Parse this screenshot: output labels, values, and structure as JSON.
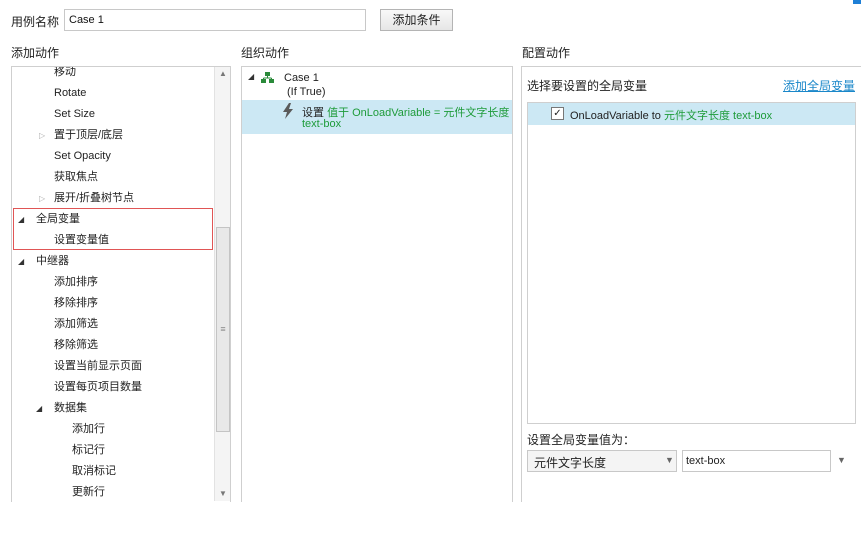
{
  "top": {
    "case_label": "用例名称",
    "case_value": "Case 1",
    "add_condition": "添加条件"
  },
  "sections": {
    "add_action": "添加动作",
    "organize_action": "组织动作",
    "configure_action": "配置动作"
  },
  "left_tree": {
    "items": [
      {
        "label": "移动"
      },
      {
        "label": "Rotate"
      },
      {
        "label": "Set Size"
      },
      {
        "label": "置于顶层/底层"
      },
      {
        "label": "Set Opacity"
      },
      {
        "label": "获取焦点"
      },
      {
        "label": "展开/折叠树节点"
      },
      {
        "label": "全局变量"
      },
      {
        "label": "设置变量值"
      },
      {
        "label": "中继器"
      },
      {
        "label": "添加排序"
      },
      {
        "label": "移除排序"
      },
      {
        "label": "添加筛选"
      },
      {
        "label": "移除筛选"
      },
      {
        "label": "设置当前显示页面"
      },
      {
        "label": "设置每页项目数量"
      },
      {
        "label": "数据集"
      },
      {
        "label": "添加行"
      },
      {
        "label": "标记行"
      },
      {
        "label": "取消标记"
      },
      {
        "label": "更新行"
      }
    ]
  },
  "middle": {
    "case_name": "Case 1",
    "case_condition": "(If True)",
    "action_prefix": "设置",
    "action_detail": "值于 OnLoadVariable = 元件文字长度",
    "action_detail_2": "text-box"
  },
  "right": {
    "select_var_title": "选择要设置的全局变量",
    "add_global_link": "添加全局变量",
    "var_name": "OnLoadVariable to",
    "var_value": "元件文字长度 text-box",
    "set_value_label": "设置全局变量值为：",
    "select_value": "元件文字长度",
    "target_value": "text-box"
  },
  "icons": {
    "check": "✓",
    "arrow_open": "◢",
    "arrow_closed": "▷",
    "dropdown": "▼",
    "scroll_up": "▲",
    "scroll_down": "▼",
    "grip": "≡"
  }
}
